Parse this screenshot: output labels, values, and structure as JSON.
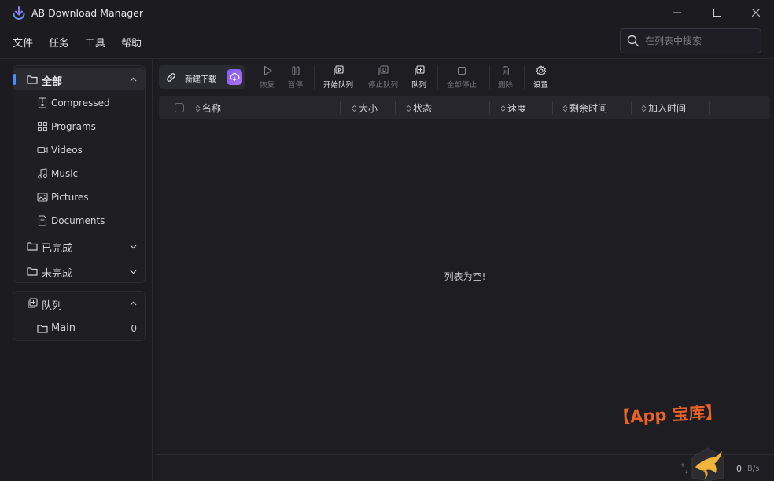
{
  "app": {
    "title": "AB Download Manager"
  },
  "window_controls": {
    "minimize": "—",
    "maximize": "☐",
    "close": "✕"
  },
  "menu": {
    "items": [
      "文件",
      "任务",
      "工具",
      "帮助"
    ]
  },
  "search": {
    "placeholder": "在列表中搜索"
  },
  "sidebar": {
    "categories": {
      "all_label": "全部",
      "items": [
        "Compressed",
        "Programs",
        "Videos",
        "Music",
        "Pictures",
        "Documents"
      ],
      "finished_label": "已完成",
      "unfinished_label": "未完成"
    },
    "queues": {
      "label": "队列",
      "items": [
        {
          "name": "Main",
          "count": "0"
        }
      ]
    }
  },
  "toolbar": {
    "new_download": "新建下载",
    "resume": "恢复",
    "pause": "暂停",
    "start_queue": "开始队列",
    "stop_queue": "停止队列",
    "queue": "队列",
    "stop_all": "全部停止",
    "delete": "删除",
    "settings": "设置"
  },
  "table": {
    "columns": [
      "名称",
      "大小",
      "状态",
      "速度",
      "剩余时间",
      "加入时间"
    ],
    "empty_message": "列表为空!"
  },
  "status_bar": {
    "speed_value": "0",
    "speed_unit": "B/s"
  },
  "watermark": {
    "text": "【App 宝库】"
  },
  "colors": {
    "accent": "#4e8ef7",
    "new_download_badge": "#8e64f3",
    "watermark": "#e8622a"
  }
}
